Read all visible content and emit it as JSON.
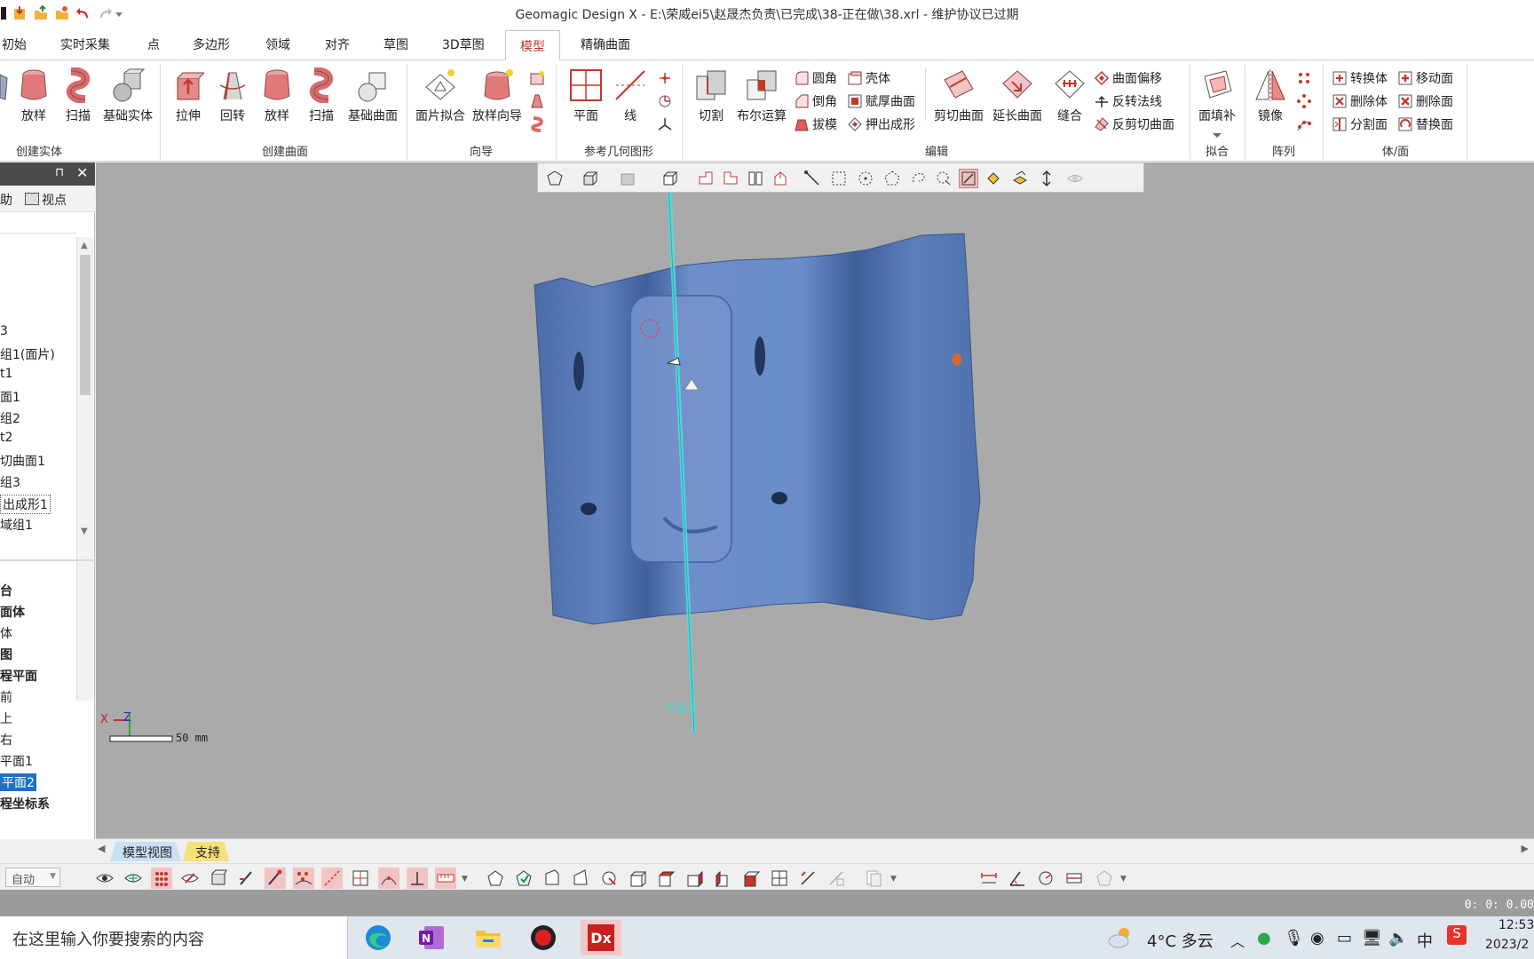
{
  "window": {
    "title": "Geomagic Design X - E:\\荣威ei5\\赵晟杰负责\\已完成\\38-正在做\\38.xrl - 维护协议已过期"
  },
  "tabs": [
    {
      "label": "初始"
    },
    {
      "label": "实时采集"
    },
    {
      "label": "点"
    },
    {
      "label": "多边形"
    },
    {
      "label": "领域"
    },
    {
      "label": "对齐"
    },
    {
      "label": "草图"
    },
    {
      "label": "3D草图"
    },
    {
      "label": "模型"
    },
    {
      "label": "精确曲面"
    }
  ],
  "ribbon": {
    "create_solid": {
      "label": "创建实体",
      "buttons": [
        "放样",
        "扫描",
        "基础实体"
      ]
    },
    "create_surface": {
      "label": "创建曲面",
      "buttons": [
        "拉伸",
        "回转",
        "放样",
        "扫描",
        "基础曲面"
      ]
    },
    "wizard": {
      "label": "向导",
      "buttons": [
        "面片拟合",
        "放样向导"
      ]
    },
    "ref_geometry": {
      "label": "参考几何图形",
      "buttons": [
        "平面",
        "线"
      ]
    },
    "edit": {
      "label": "编辑",
      "large": [
        "切割",
        "布尔运算"
      ],
      "small": [
        "圆角",
        "倒角",
        "拔模",
        "壳体",
        "赋厚曲面",
        "押出成形"
      ],
      "large2": [
        "剪切曲面",
        "延长曲面",
        "缝合"
      ],
      "small2": [
        "曲面偏移",
        "反转法线",
        "反剪切曲面"
      ]
    },
    "fit": {
      "label": "拟合",
      "buttons": [
        "面填补"
      ]
    },
    "pattern": {
      "label": "阵列",
      "buttons": [
        "镜像"
      ]
    },
    "body_face": {
      "label": "体/面",
      "small": [
        "转换体",
        "删除体",
        "分割面",
        "移动面",
        "删除面",
        "替换面"
      ]
    }
  },
  "left_panel": {
    "tools": [
      "助",
      "视点"
    ],
    "tree_top": [
      "3",
      "组1(面片)",
      "t1",
      "面1",
      "组2",
      "t2",
      "切曲面1",
      "组3",
      "出成形1",
      "域组1"
    ],
    "tree_bottom": [
      "台",
      "面体",
      "体",
      "图",
      "程平面",
      "前",
      "上",
      "右",
      "平面1",
      "平面2",
      "程坐标系"
    ]
  },
  "viewport": {
    "scale_label": "50 mm",
    "axis_x": "X",
    "axis_z": "Z",
    "plane_label": "平面2"
  },
  "bottom_tabs": [
    {
      "label": "模型视图"
    },
    {
      "label": "支持"
    }
  ],
  "bottom_toolbar": {
    "mode": "自动"
  },
  "status": {
    "coords": "0: 0: 0.00"
  },
  "taskbar": {
    "search_placeholder": "在这里输入你要搜索的内容",
    "weather": "4°C  多云",
    "ime": "中",
    "time": "12:53",
    "date": "2023/2"
  },
  "colors": {
    "accent": "#c0392b",
    "selection": "#1a73c8",
    "viewport_bg": "#aaaaaa",
    "mesh": "#5b7fb9",
    "plane": "#4fe0e0"
  }
}
